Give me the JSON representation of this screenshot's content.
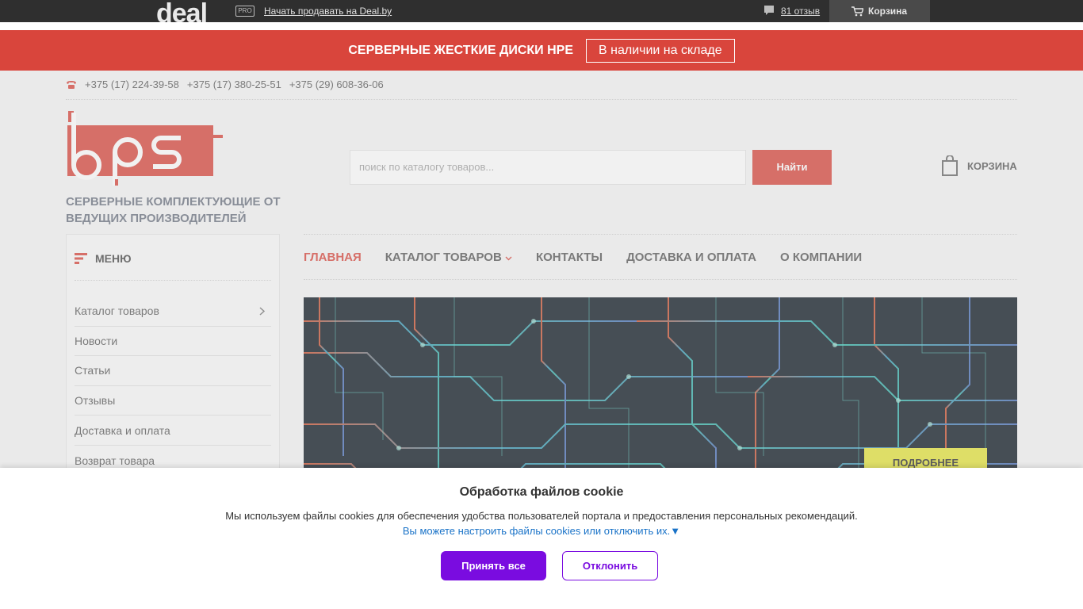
{
  "topbar": {
    "logo_text": "deal",
    "pro_badge": "PRO",
    "sell_link": "Начать продавать на Deal.by",
    "reviews_link": "81 отзыв",
    "cart_label": "Корзина"
  },
  "promo": {
    "text": "СЕРВЕРНЫЕ ЖЕСТКИЕ ДИСКИ HPE",
    "button": "В наличии на складе"
  },
  "contacts": {
    "phones": [
      "+375 (17) 224-39-58",
      "+375 (17) 380-25-51",
      "+375 (29) 608-36-06"
    ]
  },
  "header": {
    "logo_text": "bps",
    "tagline": "СЕРВЕРНЫЕ КОМПЛЕКТУЮЩИЕ ОТ ВЕДУЩИХ ПРОИЗВОДИТЕЛЕЙ",
    "search_placeholder": "поиск по каталогу товаров...",
    "search_button": "Найти",
    "cart_label": "КОРЗИНА"
  },
  "sidebar": {
    "title": "МЕНЮ",
    "items": [
      {
        "label": "Каталог товаров"
      },
      {
        "label": "Новости"
      },
      {
        "label": "Статьи"
      },
      {
        "label": "Отзывы"
      },
      {
        "label": "Доставка и оплата"
      },
      {
        "label": "Возврат товара"
      }
    ]
  },
  "nav": {
    "items": [
      {
        "label": "ГЛАВНАЯ"
      },
      {
        "label": "КАТАЛОГ ТОВАРОВ"
      },
      {
        "label": "КОНТАКТЫ"
      },
      {
        "label": "ДОСТАВКА И ОПЛАТА"
      },
      {
        "label": "О КОМПАНИИ"
      }
    ]
  },
  "hero": {
    "button": "ПОДРОБНЕЕ"
  },
  "cookie": {
    "title": "Обработка файлов cookie",
    "text": "Мы используем файлы cookies для обеспечения удобства пользователей портала и предоставления персональных рекомендаций.",
    "settings_link": "Вы можете настроить файлы cookies или отключить их.▼",
    "accept": "Принять все",
    "decline": "Отклонить"
  },
  "colors": {
    "brand_red": "#d9453c",
    "cookie_purple": "#7a0ce0",
    "link_blue": "#1a73c8"
  }
}
